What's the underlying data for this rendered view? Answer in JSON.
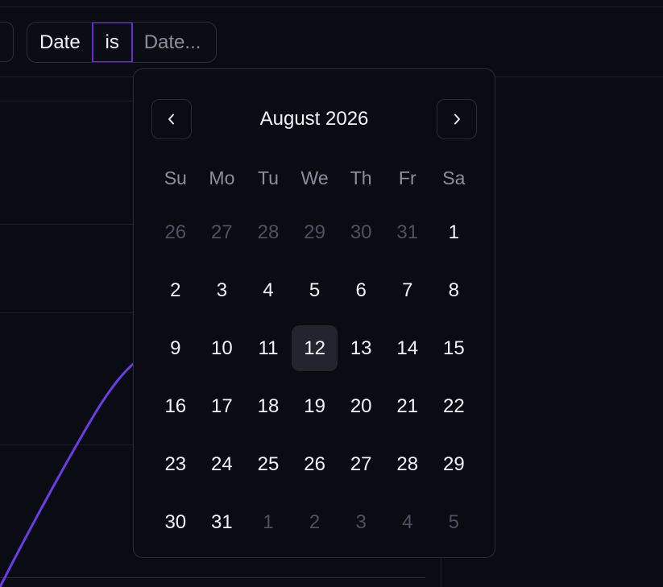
{
  "filter": {
    "field": "Date",
    "operator": "is",
    "value_placeholder": "Date..."
  },
  "date_picker": {
    "month_label": "August 2026",
    "prev_icon": "chevron-left-icon",
    "next_icon": "chevron-right-icon",
    "weekdays": [
      "Su",
      "Mo",
      "Tu",
      "We",
      "Th",
      "Fr",
      "Sa"
    ],
    "selected_day": "12",
    "weeks": [
      [
        {
          "d": "26",
          "out": true
        },
        {
          "d": "27",
          "out": true
        },
        {
          "d": "28",
          "out": true
        },
        {
          "d": "29",
          "out": true
        },
        {
          "d": "30",
          "out": true
        },
        {
          "d": "31",
          "out": true
        },
        {
          "d": "1",
          "out": false
        }
      ],
      [
        {
          "d": "2",
          "out": false
        },
        {
          "d": "3",
          "out": false
        },
        {
          "d": "4",
          "out": false
        },
        {
          "d": "5",
          "out": false
        },
        {
          "d": "6",
          "out": false
        },
        {
          "d": "7",
          "out": false
        },
        {
          "d": "8",
          "out": false
        }
      ],
      [
        {
          "d": "9",
          "out": false
        },
        {
          "d": "10",
          "out": false
        },
        {
          "d": "11",
          "out": false
        },
        {
          "d": "12",
          "out": false
        },
        {
          "d": "13",
          "out": false
        },
        {
          "d": "14",
          "out": false
        },
        {
          "d": "15",
          "out": false
        }
      ],
      [
        {
          "d": "16",
          "out": false
        },
        {
          "d": "17",
          "out": false
        },
        {
          "d": "18",
          "out": false
        },
        {
          "d": "19",
          "out": false
        },
        {
          "d": "20",
          "out": false
        },
        {
          "d": "21",
          "out": false
        },
        {
          "d": "22",
          "out": false
        }
      ],
      [
        {
          "d": "23",
          "out": false
        },
        {
          "d": "24",
          "out": false
        },
        {
          "d": "25",
          "out": false
        },
        {
          "d": "26",
          "out": false
        },
        {
          "d": "27",
          "out": false
        },
        {
          "d": "28",
          "out": false
        },
        {
          "d": "29",
          "out": false
        }
      ],
      [
        {
          "d": "30",
          "out": false
        },
        {
          "d": "31",
          "out": false
        },
        {
          "d": "1",
          "out": true
        },
        {
          "d": "2",
          "out": true
        },
        {
          "d": "3",
          "out": true
        },
        {
          "d": "4",
          "out": true
        },
        {
          "d": "5",
          "out": true
        }
      ]
    ]
  },
  "colors": {
    "background": "#0a0c14",
    "accent": "#6d28d9",
    "line": "#6d3ae8",
    "border": "#2a2d38"
  }
}
